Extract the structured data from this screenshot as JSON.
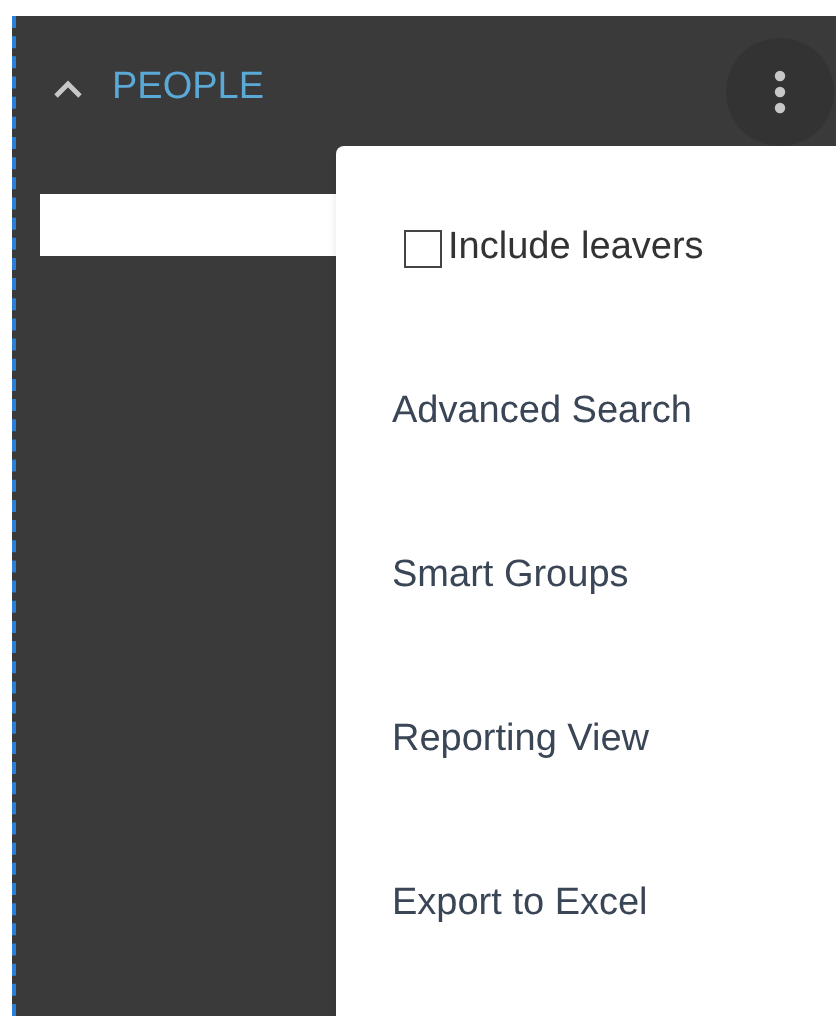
{
  "section": {
    "title": "PEOPLE",
    "expanded": true
  },
  "menu": [
    {
      "kind": "checkbox",
      "label": "Include leavers",
      "checked": false
    },
    {
      "kind": "action",
      "label": "Advanced Search"
    },
    {
      "kind": "action",
      "label": "Smart Groups"
    },
    {
      "kind": "action",
      "label": "Reporting View"
    },
    {
      "kind": "action",
      "label": "Export to Excel"
    }
  ]
}
